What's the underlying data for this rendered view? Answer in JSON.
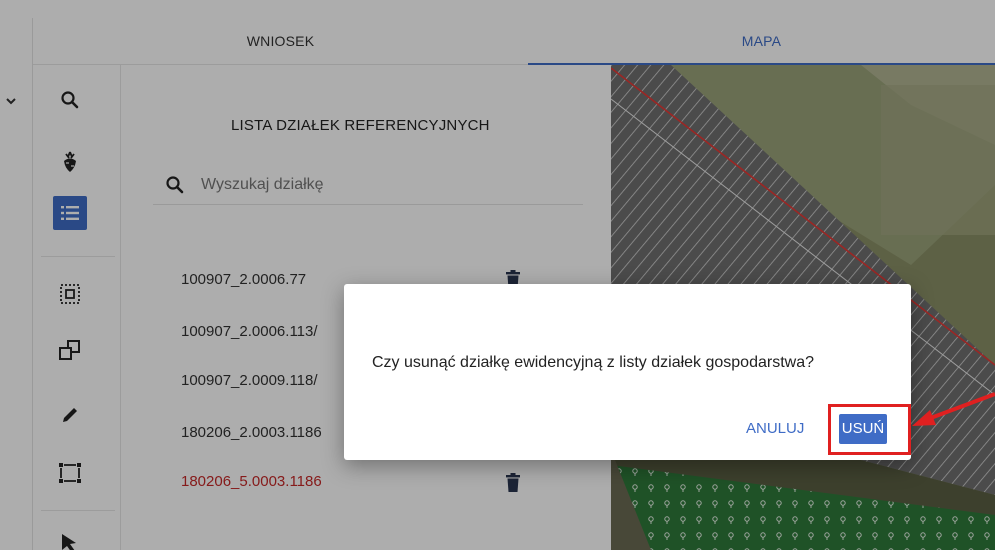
{
  "tabs": [
    {
      "label": "WNIOSEK",
      "active": false
    },
    {
      "label": "MAPA",
      "active": true
    }
  ],
  "toolbar": {
    "items": [
      {
        "name": "search-tool",
        "icon": "search-icon",
        "active": false
      },
      {
        "name": "crop-tool",
        "icon": "beet-icon",
        "active": false
      },
      {
        "name": "list-tool",
        "icon": "list-icon",
        "active": true
      },
      {
        "name": "select-area-tool",
        "icon": "select-area-icon",
        "active": false
      },
      {
        "name": "copy-tool",
        "icon": "copy-icon",
        "active": false
      },
      {
        "name": "edit-tool",
        "icon": "pencil-icon",
        "active": false
      },
      {
        "name": "bounding-box-tool",
        "icon": "bounding-box-icon",
        "active": false
      },
      {
        "name": "pointer-tool",
        "icon": "cursor-icon",
        "active": false
      }
    ]
  },
  "panel": {
    "title": "LISTA DZIAŁEK REFERENCYJNYCH",
    "search_placeholder": "Wyszukaj działkę",
    "plots": [
      {
        "id": "100907_2.0006.77",
        "highlighted": false,
        "has_delete": true
      },
      {
        "id": "100907_2.0006.113/",
        "highlighted": false,
        "has_delete": false
      },
      {
        "id": "100907_2.0009.118/",
        "highlighted": false,
        "has_delete": false
      },
      {
        "id": "180206_2.0003.1186",
        "highlighted": false,
        "has_delete": false
      },
      {
        "id": "180206_5.0003.1186",
        "highlighted": true,
        "has_delete": true
      }
    ]
  },
  "dialog": {
    "message": "Czy usunąć działkę ewidencyjną z listy działek gospodarstwa?",
    "cancel_label": "ANULUJ",
    "confirm_label": "USUŃ"
  },
  "colors": {
    "accent": "#3f6cc6",
    "highlight": "#c62828",
    "annotation": "#e02020"
  }
}
